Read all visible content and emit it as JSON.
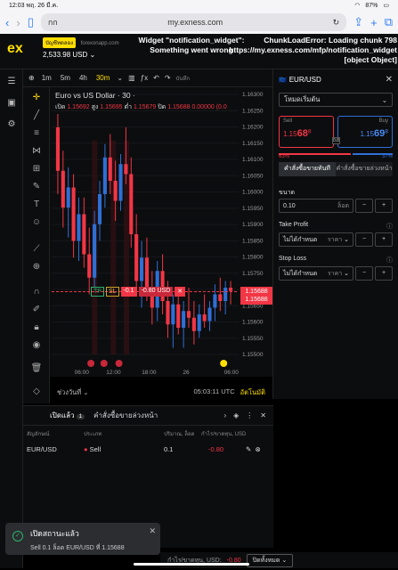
{
  "status": {
    "time": "12:03",
    "date": "พฤ. 26 มี.ค.",
    "battery": "87%"
  },
  "browser": {
    "tab_label": "กก",
    "url": "my.exness.com"
  },
  "app": {
    "logo": "ex",
    "demo_badge": "บัญชีทดลอง",
    "server": "forexonapp.com",
    "balance": "2,533.98 USD",
    "error_widget": "Widget \"notification_widget\": Something went wrong",
    "error_chunk": "ChunkLoadError: Loading chunk 798 https://my.exness.com/mfp/notification_widget [object Object]"
  },
  "toolbar": {
    "timeframes": [
      "1m",
      "5m",
      "4h",
      "30m"
    ],
    "active_tf": "30m",
    "save_label": "บันทึก"
  },
  "chart": {
    "title": "Euro vs US Dollar · 30 ·",
    "ohlc_open_label": "เปิด",
    "ohlc_open": "1.15692",
    "ohlc_high_label": "สูง",
    "ohlc_high": "1.15695",
    "ohlc_low_label": "ต่ำ",
    "ohlc_low": "1.15679",
    "ohlc_close_label": "ปิด",
    "ohlc_close": "1.15688",
    "ohlc_change": "0.00000 (0.0",
    "tp": "TP",
    "sl": "SL",
    "pl": "-0.1",
    "pl_usd": "-0.80 USD",
    "close_x": "✕",
    "price_badge_1": "1.15688",
    "price_badge_2": "1.15688",
    "range_label": "ช่วงวันที่",
    "clock": "05:03:11 UTC",
    "auto": "อัตโนมัติ"
  },
  "chart_data": {
    "type": "candlestick",
    "title": "Euro vs US Dollar · 30",
    "ylim": [
      1.155,
      1.163
    ],
    "yticks": [
      "1.16300",
      "1.16250",
      "1.16200",
      "1.16150",
      "1.16100",
      "1.16050",
      "1.16000",
      "1.15950",
      "1.15900",
      "1.15850",
      "1.15800",
      "1.15750",
      "1.15700",
      "1.15650",
      "1.15600",
      "1.15550",
      "1.15500"
    ],
    "xticks": [
      "06:00",
      "12:00",
      "18:00",
      "26",
      "06:00"
    ],
    "open_price": 1.15688,
    "colors": {
      "up": "#2f6fd6",
      "down": "#f23645"
    },
    "candles": [
      [
        1.1618,
        1.1622,
        1.1598,
        1.1605
      ],
      [
        1.1605,
        1.1611,
        1.1588,
        1.1594
      ],
      [
        1.1594,
        1.1606,
        1.1585,
        1.16
      ],
      [
        1.16,
        1.1604,
        1.1579,
        1.1584
      ],
      [
        1.1584,
        1.1597,
        1.1578,
        1.1592
      ],
      [
        1.1592,
        1.1597,
        1.1576,
        1.158
      ],
      [
        1.158,
        1.1588,
        1.1568,
        1.1573
      ],
      [
        1.1573,
        1.1593,
        1.157,
        1.1589
      ],
      [
        1.1589,
        1.1602,
        1.1584,
        1.1598
      ],
      [
        1.1598,
        1.1613,
        1.1594,
        1.1609
      ],
      [
        1.1609,
        1.1616,
        1.1598,
        1.1602
      ],
      [
        1.1602,
        1.1608,
        1.159,
        1.1596
      ],
      [
        1.1596,
        1.161,
        1.1593,
        1.1607
      ],
      [
        1.1607,
        1.1618,
        1.1601,
        1.1604
      ],
      [
        1.1604,
        1.1609,
        1.1582,
        1.1586
      ],
      [
        1.1586,
        1.1592,
        1.1568,
        1.1572
      ],
      [
        1.1572,
        1.1584,
        1.1564,
        1.1579
      ],
      [
        1.1579,
        1.1585,
        1.1566,
        1.1569
      ],
      [
        1.1569,
        1.1575,
        1.1559,
        1.1564
      ],
      [
        1.1564,
        1.1578,
        1.156,
        1.1575
      ],
      [
        1.1575,
        1.158,
        1.1562,
        1.1566
      ],
      [
        1.1566,
        1.1572,
        1.1555,
        1.1559
      ],
      [
        1.1559,
        1.1568,
        1.1552,
        1.1565
      ],
      [
        1.1565,
        1.157,
        1.1556,
        1.1558
      ],
      [
        1.1558,
        1.1566,
        1.1552,
        1.1563
      ],
      [
        1.1563,
        1.157,
        1.1558,
        1.1561
      ],
      [
        1.1561,
        1.1566,
        1.1553,
        1.1557
      ],
      [
        1.1557,
        1.1565,
        1.1555,
        1.1562
      ],
      [
        1.1562,
        1.1568,
        1.1558,
        1.156
      ],
      [
        1.156,
        1.1566,
        1.1557,
        1.1564
      ],
      [
        1.1564,
        1.1571,
        1.156,
        1.1568
      ],
      [
        1.1568,
        1.1573,
        1.1563,
        1.1566
      ],
      [
        1.1566,
        1.1572,
        1.1562,
        1.157
      ],
      [
        1.157,
        1.1572,
        1.1565,
        1.1569
      ]
    ]
  },
  "order_panel": {
    "symbol": "EUR/USD",
    "mode": "โหมดเริ่มต้น",
    "sell_label": "Sell",
    "sell_price_main": "1.15",
    "sell_price_big": "68",
    "sell_price_sup": "8",
    "buy_label": "Buy",
    "buy_price_main": "1.15",
    "buy_price_big": "69",
    "buy_price_sup": "8",
    "spread": "0.8",
    "sell_pct": 63,
    "buy_pct": 37,
    "sell_pct_label": "63%",
    "buy_pct_label": "37%",
    "tab_market": "คำสั่งซื้อขายทันที",
    "tab_pending": "คำสั่งซื้อขายล่วงหน้า",
    "volume_label": "ขนาด",
    "volume": "0.10",
    "volume_unit": "ล็อต",
    "tp_label": "Take Profit",
    "tp_value": "ไม่ได้กำหนด",
    "tp_unit": "ราคา",
    "sl_label": "Stop Loss",
    "sl_value": "ไม่ได้กำหนด",
    "sl_unit": "ราคา"
  },
  "positions": {
    "tab_open": "เปิดแล้ว",
    "open_count": "1",
    "tab_pending": "คำสั่งซื้อขายล่วงหน้า",
    "col_symbol": "สัญลักษณ์",
    "col_type": "ประเภท",
    "col_volume": "ปริมาณ, ล็อต",
    "col_pl": "กำไร/ขาดทุน, USD",
    "row_symbol": "EUR/USD",
    "row_type": "Sell",
    "row_volume": "0.1",
    "row_pl": "-0.80"
  },
  "toast": {
    "title": "เปิดสถานะแล้ว",
    "message": "Sell 0.1 ล็อต EUR/USD ที่ 1.15688"
  },
  "footer": {
    "pl_label": "กำไร/ขาดทุน, USD:",
    "pl_value": "-0.80",
    "close_all": "ปิดทั้งหมด"
  }
}
